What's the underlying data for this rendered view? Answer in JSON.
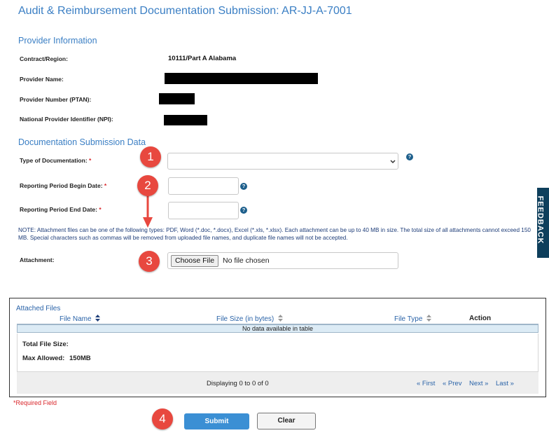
{
  "page_title": "Audit & Reimbursement Documentation Submission: AR-JJ-A-7001",
  "provider_section": {
    "heading": "Provider Information",
    "contract_label": "Contract/Region:",
    "contract_value": "10111/Part A Alabama",
    "provider_name_label": "Provider Name:",
    "ptan_label": "Provider Number (PTAN):",
    "npi_label": "National Provider Identifier (NPI):"
  },
  "submission_section": {
    "heading": "Documentation Submission Data",
    "type_label": "Type of Documentation:",
    "begin_label": "Reporting Period Begin Date:",
    "end_label": "Reporting Period End Date:",
    "required_marker": "*",
    "help_glyph": "?",
    "note": "NOTE: Attachment files can be one of the following types: PDF, Word (*.doc, *.docx), Excel (*.xls, *.xlsx).  Each attachment can be up to 40 MB in size.   The total size of all attachments cannot exceed 150 MB. Special characters such as commas will be removed from uploaded file names, and duplicate file names will not be accepted.",
    "attachment_label": "Attachment:",
    "choose_file_label": "Choose File",
    "no_file_text": "No file chosen"
  },
  "feedback_tab": "FEEDBACK",
  "attached_files": {
    "caption": "Attached Files",
    "columns": [
      "File Name",
      "File Size (in bytes)",
      "File Type",
      "Action"
    ],
    "empty_text": "No data available in table",
    "total_label": "Total File Size:",
    "max_label": "Max Allowed:",
    "max_value": "150MB",
    "info": "Displaying 0 to 0 of 0",
    "pager": [
      "« First",
      "« Prev",
      "Next »",
      "Last »"
    ]
  },
  "required_field": "*Required Field",
  "buttons": {
    "submit": "Submit",
    "clear": "Clear"
  },
  "annotations": [
    "1",
    "2",
    "3",
    "4"
  ],
  "colors": {
    "accent": "#3b7fc4",
    "required": "#d9262b",
    "badge": "#e8483f",
    "submit": "#3b8fd4",
    "feedback": "#0e3f5c"
  }
}
